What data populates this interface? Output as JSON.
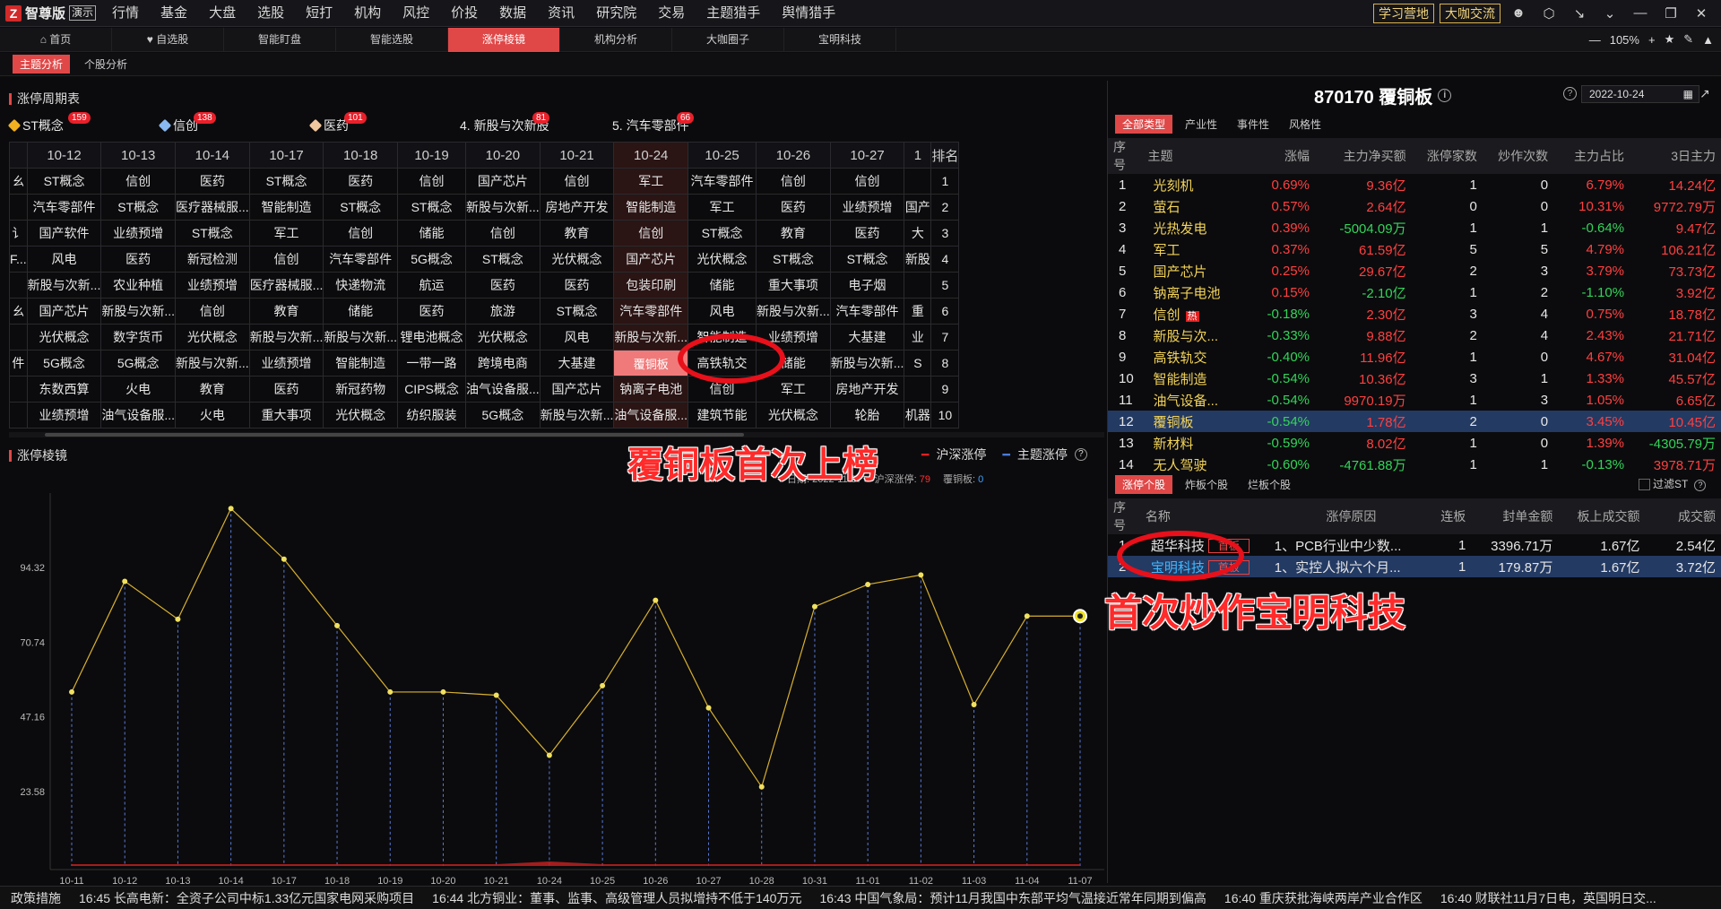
{
  "app": {
    "brand": "智尊版",
    "demo": "演示"
  },
  "menu": [
    {
      "label": "行情",
      "dot": false
    },
    {
      "label": "基金",
      "dot": true
    },
    {
      "label": "大盘",
      "dot": false
    },
    {
      "label": "选股",
      "dot": true
    },
    {
      "label": "短打",
      "dot": false
    },
    {
      "label": "机构",
      "dot": false
    },
    {
      "label": "风控",
      "dot": false
    },
    {
      "label": "价投",
      "dot": false
    },
    {
      "label": "数据",
      "dot": false
    },
    {
      "label": "资讯",
      "dot": false
    },
    {
      "label": "研究院",
      "dot": false
    },
    {
      "label": "交易",
      "dot": false
    },
    {
      "label": "主题猎手",
      "dot": false
    },
    {
      "label": "舆情猎手",
      "dot": false
    }
  ],
  "menu_right": {
    "learn": "学习营地",
    "exchange": "大咖交流"
  },
  "tabs": [
    "首页",
    "自选股",
    "智能盯盘",
    "智能选股",
    "涨停棱镜",
    "机构分析",
    "大咖圈子",
    "宝明科技"
  ],
  "active_tab": "涨停棱镜",
  "zoom": "105%",
  "subtabs": [
    "主题分析",
    "个股分析"
  ],
  "section1_title": "涨停周期表",
  "themes": [
    {
      "label": "ST概念",
      "count": "159",
      "color": "#f0b020"
    },
    {
      "label": "信创",
      "count": "138",
      "color": "#8ab8f0"
    },
    {
      "label": "医药",
      "count": "101",
      "color": "#f0c8a0"
    },
    {
      "label": "4. 新股与次新股",
      "count": "81",
      "color": ""
    },
    {
      "label": "5. 汽车零部件",
      "count": "66",
      "color": ""
    }
  ],
  "cycle": {
    "dates": [
      "10-12",
      "10-13",
      "10-14",
      "10-17",
      "10-18",
      "10-19",
      "10-20",
      "10-21",
      "10-24",
      "10-25",
      "10-26",
      "10-27",
      "1"
    ],
    "rank_header": "排名",
    "left_stub": [
      "ㄠ",
      "",
      "讠",
      "F...",
      "",
      "ㄠ",
      "",
      "件",
      "",
      ""
    ],
    "rows": [
      [
        "ST概念",
        "信创",
        "医药",
        "ST概念",
        "医药",
        "信创",
        "国产芯片",
        "信创",
        "军工",
        "汽车零部件",
        "信创",
        "信创",
        "",
        1
      ],
      [
        "汽车零部件",
        "ST概念",
        "医疗器械服...",
        "智能制造",
        "ST概念",
        "ST概念",
        "新股与次新...",
        "房地产开发",
        "智能制造",
        "军工",
        "医药",
        "业绩预增",
        "国产",
        "2"
      ],
      [
        "国产软件",
        "业绩预增",
        "ST概念",
        "军工",
        "信创",
        "储能",
        "信创",
        "教育",
        "信创",
        "ST概念",
        "教育",
        "医药",
        "大",
        "3"
      ],
      [
        "风电",
        "医药",
        "新冠检测",
        "信创",
        "汽车零部件",
        "5G概念",
        "ST概念",
        "光伏概念",
        "国产芯片",
        "光伏概念",
        "ST概念",
        "ST概念",
        "新股",
        "4"
      ],
      [
        "新股与次新...",
        "农业种植",
        "业绩预增",
        "医疗器械服...",
        "快递物流",
        "航运",
        "医药",
        "医药",
        "包装印刷",
        "储能",
        "重大事项",
        "电子烟",
        "",
        "5"
      ],
      [
        "国产芯片",
        "新股与次新...",
        "信创",
        "教育",
        "储能",
        "医药",
        "旅游",
        "ST概念",
        "汽车零部件",
        "风电",
        "新股与次新...",
        "汽车零部件",
        "重",
        "6"
      ],
      [
        "光伏概念",
        "数字货币",
        "光伏概念",
        "新股与次新...",
        "新股与次新...",
        "锂电池概念",
        "光伏概念",
        "风电",
        "新股与次新...",
        "智能制造",
        "业绩预增",
        "大基建",
        "业",
        "7"
      ],
      [
        "5G概念",
        "5G概念",
        "新股与次新...",
        "业绩预增",
        "智能制造",
        "一带一路",
        "跨境电商",
        "大基建",
        "覆铜板",
        "高铁轨交",
        "储能",
        "新股与次新...",
        "S",
        "8"
      ],
      [
        "东数西算",
        "火电",
        "教育",
        "医药",
        "新冠药物",
        "CIPS概念",
        "油气设备服...",
        "国产芯片",
        "钠离子电池",
        "信创",
        "军工",
        "房地产开发",
        "",
        "9"
      ],
      [
        "业绩预增",
        "油气设备服...",
        "火电",
        "重大事项",
        "光伏概念",
        "纺织服装",
        "5G概念",
        "新股与次新...",
        "油气设备服...",
        "建筑节能",
        "光伏概念",
        "轮胎",
        "机器",
        "10"
      ]
    ]
  },
  "section2_title": "涨停棱镜",
  "legend": {
    "a": "沪深涨停",
    "b": "主题涨停"
  },
  "chart_info": {
    "date_label": "日期:",
    "date": "2022-11-07",
    "hs_label": "沪深涨停:",
    "hs": "79",
    "theme_label": "覆铜板:",
    "theme": "0"
  },
  "chart_data": {
    "type": "line",
    "x": [
      "10-11",
      "10-12",
      "10-13",
      "10-14",
      "10-17",
      "10-18",
      "10-19",
      "10-20",
      "10-21",
      "10-24",
      "10-25",
      "10-26",
      "10-27",
      "10-28",
      "10-31",
      "11-01",
      "11-02",
      "11-03",
      "11-04",
      "11-07"
    ],
    "series": [
      {
        "name": "沪深涨停",
        "values": [
          55,
          90,
          78,
          113,
          97,
          76,
          55,
          55,
          54,
          35,
          57,
          84,
          50,
          25,
          82,
          89,
          92,
          51,
          79,
          79
        ]
      },
      {
        "name": "主题涨停",
        "values": [
          0,
          0,
          0,
          0,
          0,
          0,
          0,
          0,
          0,
          1,
          0,
          0,
          0,
          0,
          0,
          0,
          0,
          0,
          0,
          0
        ]
      }
    ],
    "yticks": [
      "94.32",
      "70.74",
      "47.16",
      "23.58"
    ],
    "ytick_values": [
      94.32,
      70.74,
      47.16,
      23.58
    ],
    "ylim": [
      0,
      117.9
    ],
    "colors": {
      "line": "#d8b030",
      "dot": "#f0e060",
      "drop": "#5a7ad8",
      "area": "#c02020"
    }
  },
  "annotations": {
    "a1": "覆铜板首次上榜",
    "a2": "首次炒作宝明科技"
  },
  "stock": {
    "code_name": "870170 覆铜板",
    "date": "2022-10-24"
  },
  "type_tabs": [
    "全部类型",
    "产业性",
    "事件性",
    "风格性"
  ],
  "theme_table": {
    "headers": [
      "序号",
      "主题",
      "涨幅",
      "主力净买额",
      "涨停家数",
      "炒作次数",
      "主力占比",
      "3日主力"
    ],
    "rows": [
      [
        "1",
        "光刻机",
        "0.69%",
        "9.36亿",
        "1",
        "0",
        "6.79%",
        "14.24亿",
        "r",
        "r",
        "r",
        "r"
      ],
      [
        "2",
        "萤石",
        "0.57%",
        "2.64亿",
        "0",
        "0",
        "10.31%",
        "9772.79万",
        "r",
        "r",
        "r",
        "r"
      ],
      [
        "3",
        "光热发电",
        "0.39%",
        "-5004.09万",
        "1",
        "1",
        "-0.64%",
        "9.47亿",
        "r",
        "g",
        "g",
        "r"
      ],
      [
        "4",
        "军工",
        "0.37%",
        "61.59亿",
        "5",
        "5",
        "4.79%",
        "106.21亿",
        "r",
        "r",
        "r",
        "r"
      ],
      [
        "5",
        "国产芯片",
        "0.25%",
        "29.67亿",
        "2",
        "3",
        "3.79%",
        "73.73亿",
        "r",
        "r",
        "r",
        "r"
      ],
      [
        "6",
        "钠离子电池",
        "0.15%",
        "-2.10亿",
        "1",
        "2",
        "-1.10%",
        "3.92亿",
        "r",
        "g",
        "g",
        "r"
      ],
      [
        "7",
        "信创",
        "-0.18%",
        "2.30亿",
        "3",
        "4",
        "0.75%",
        "18.78亿",
        "g",
        "r",
        "r",
        "r"
      ],
      [
        "8",
        "新股与次...",
        "-0.33%",
        "9.88亿",
        "2",
        "4",
        "2.43%",
        "21.71亿",
        "g",
        "r",
        "r",
        "r"
      ],
      [
        "9",
        "高铁轨交",
        "-0.40%",
        "11.96亿",
        "1",
        "0",
        "4.67%",
        "31.04亿",
        "g",
        "r",
        "r",
        "r"
      ],
      [
        "10",
        "智能制造",
        "-0.54%",
        "10.36亿",
        "3",
        "1",
        "1.33%",
        "45.57亿",
        "g",
        "r",
        "r",
        "r"
      ],
      [
        "11",
        "油气设备...",
        "-0.54%",
        "9970.19万",
        "1",
        "3",
        "1.05%",
        "6.65亿",
        "g",
        "r",
        "r",
        "r"
      ],
      [
        "12",
        "覆铜板",
        "-0.54%",
        "1.78亿",
        "2",
        "0",
        "3.45%",
        "10.45亿",
        "g",
        "r",
        "r",
        "r"
      ],
      [
        "13",
        "新材料",
        "-0.59%",
        "8.02亿",
        "1",
        "0",
        "1.39%",
        "-4305.79万",
        "g",
        "r",
        "r",
        "g"
      ],
      [
        "14",
        "无人驾驶",
        "-0.60%",
        "-4761.88万",
        "1",
        "1",
        "-0.13%",
        "3978.71万",
        "g",
        "g",
        "g",
        "r"
      ]
    ],
    "hot_tag": "热"
  },
  "stock_tabs": [
    "涨停个股",
    "炸板个股",
    "烂板个股"
  ],
  "filter_st": "过滤ST",
  "stock_table": {
    "headers": [
      "序号",
      "名称",
      "",
      "涨停原因",
      "连板",
      "封单金额",
      "板上成交额",
      "成交额"
    ],
    "rows": [
      [
        "1",
        "超华科技",
        "首板",
        "1、PCB行业中少数...",
        "1",
        "3396.71万",
        "1.67亿",
        "2.54亿"
      ],
      [
        "2",
        "宝明科技",
        "首板",
        "1、实控人拟六个月...",
        "1",
        "179.87万",
        "1.67亿",
        "3.72亿"
      ]
    ]
  },
  "ticker": [
    "政策措施",
    "16:45 长高电新：全资子公司中标1.33亿元国家电网采购项目",
    "16:44 北方铜业：董事、监事、高级管理人员拟增持不低于140万元",
    "16:43 中国气象局：预计11月我国中东部平均气温接近常年同期到偏高",
    "16:40 重庆获批海峡两岸产业合作区",
    "16:40 财联社11月7日电，英国明日交..."
  ]
}
